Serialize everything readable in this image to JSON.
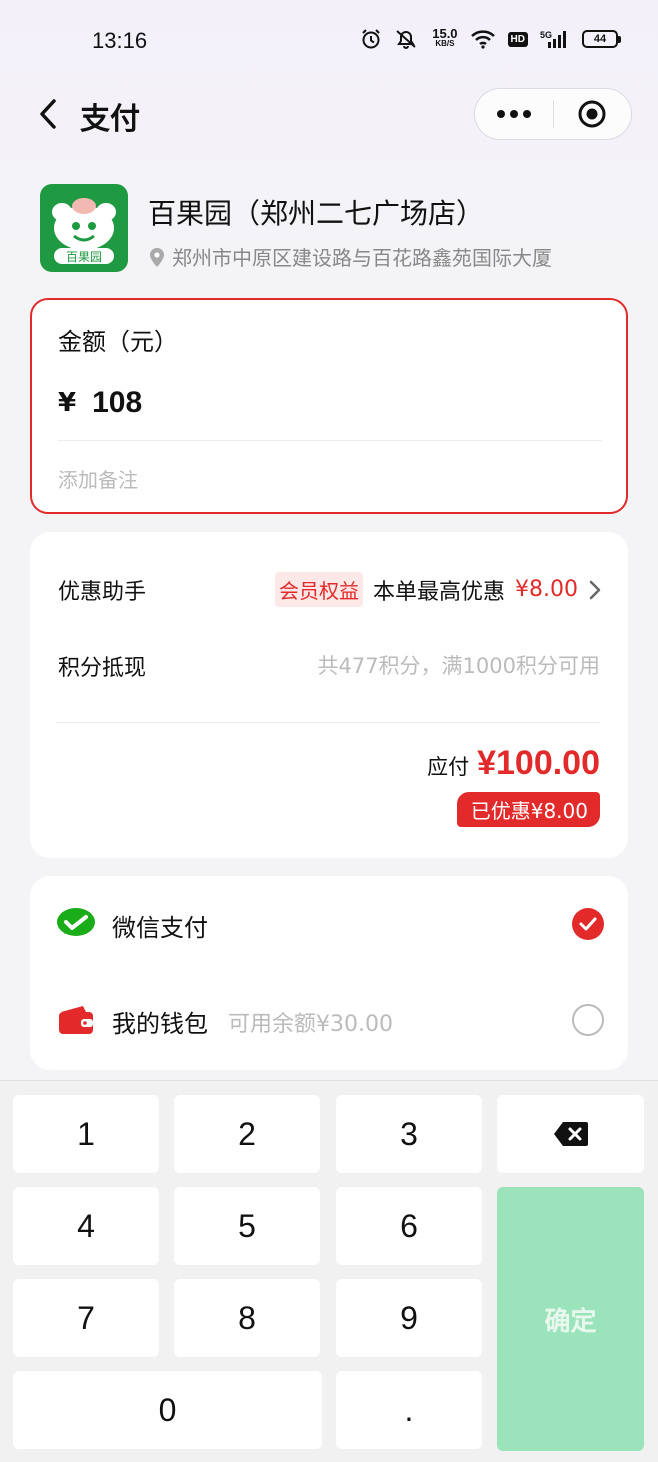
{
  "status_bar": {
    "time": "13:16",
    "net_speed_value": "15.0",
    "net_speed_unit": "KB/S",
    "hd_label": "HD",
    "network_label": "5G",
    "battery": "44"
  },
  "nav": {
    "title": "支付"
  },
  "merchant": {
    "name": "百果园（郑州二七广场店）",
    "address": "郑州市中原区建设路与百花路鑫苑国际大厦",
    "logo_text": "百果园"
  },
  "amount": {
    "label": "金额（元）",
    "currency": "¥",
    "value": "108",
    "remark_placeholder": "添加备注"
  },
  "discount": {
    "promo_label": "优惠助手",
    "member_badge": "会员权益",
    "promo_text": "本单最高优惠",
    "promo_amount": "¥8.00",
    "points_label": "积分抵现",
    "points_text": "共477积分，满1000积分可用",
    "payable_label": "应付",
    "payable_value": "¥100.00",
    "saved_text": "已优惠¥8.00"
  },
  "payment": {
    "wechat_label": "微信支付",
    "wallet_label": "我的钱包",
    "wallet_balance": "可用余额¥30.00",
    "selected": "wechat"
  },
  "keypad": {
    "keys": [
      "1",
      "2",
      "3",
      "4",
      "5",
      "6",
      "7",
      "8",
      "9",
      "0",
      "."
    ],
    "confirm_label": "确定"
  },
  "colors": {
    "accent_red": "#e32a2a",
    "confirm_green": "#9be3bb",
    "wechat_green": "#1aad19",
    "brand_green": "#1f9a42"
  },
  "icons": {
    "back": "chevron-left-icon",
    "more": "more-dots-icon",
    "close_target": "target-circle-icon",
    "location": "location-pin-icon",
    "wechat": "wechat-pay-icon",
    "wallet": "wallet-icon",
    "backspace": "backspace-icon",
    "chevron": "chevron-right-icon"
  }
}
